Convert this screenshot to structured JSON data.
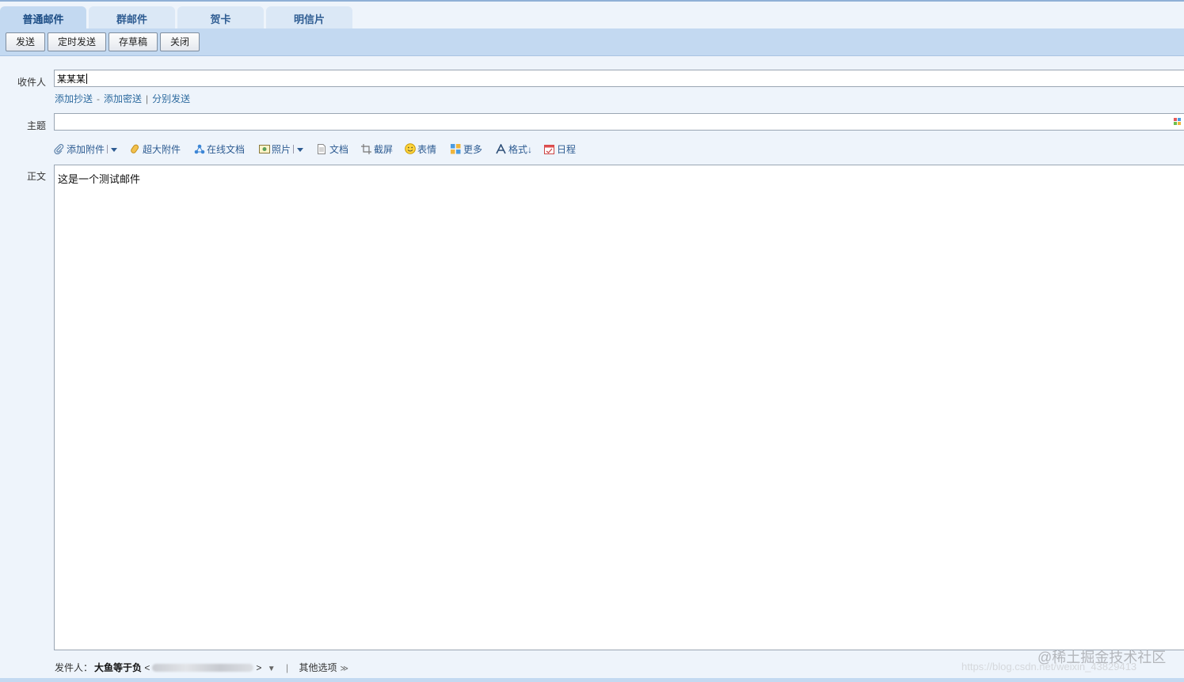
{
  "tabs": [
    {
      "label": "普通邮件",
      "active": true
    },
    {
      "label": "群邮件",
      "active": false
    },
    {
      "label": "贺卡",
      "active": false
    },
    {
      "label": "明信片",
      "active": false
    }
  ],
  "toolbar": {
    "send": "发送",
    "scheduled_send": "定时发送",
    "save_draft": "存草稿",
    "close": "关闭"
  },
  "recipient": {
    "label": "收件人",
    "value": "某某某",
    "links": {
      "add_cc": "添加抄送",
      "dash": "-",
      "add_bcc": "添加密送",
      "bar": "|",
      "separate_send": "分别发送"
    }
  },
  "subject": {
    "label": "主题",
    "value": ""
  },
  "attach_bar": [
    {
      "label": "添加附件",
      "icon": "paperclip-icon",
      "dropdown": true
    },
    {
      "label": "超大附件",
      "icon": "large-attachment-icon",
      "dropdown": false
    },
    {
      "label": "在线文档",
      "icon": "online-doc-icon",
      "dropdown": false
    },
    {
      "label": "照片",
      "icon": "photo-icon",
      "dropdown": true
    },
    {
      "label": "文档",
      "icon": "document-icon",
      "dropdown": false
    },
    {
      "label": "截屏",
      "icon": "screenshot-icon",
      "dropdown": false
    },
    {
      "label": "表情",
      "icon": "emoji-icon",
      "dropdown": false
    },
    {
      "label": "更多",
      "icon": "more-icon",
      "dropdown": false
    },
    {
      "label": "格式↓",
      "icon": "format-icon",
      "dropdown": false
    },
    {
      "label": "日程",
      "icon": "calendar-icon",
      "dropdown": false
    }
  ],
  "body": {
    "label": "正文",
    "text": "这是一个测试邮件"
  },
  "footer": {
    "sender_label": "发件人：",
    "sender_name": "大鱼等于负",
    "addr_open": "<",
    "addr_close": ">",
    "dropdown_arrow": "▼",
    "separator": "|",
    "other_options": "其他选项",
    "options_arrow": "≫"
  },
  "watermark": {
    "line1": "@稀土掘金技术社区",
    "line2": "https://blog.csdn.net/weixin_43829413"
  },
  "colors": {
    "tab_active": "#c3d9f1",
    "tab_inactive": "#dbe8f6",
    "toolbar_bg": "#c3d9f1",
    "link": "#2e6b9f",
    "page_bg": "#eef4fb"
  }
}
